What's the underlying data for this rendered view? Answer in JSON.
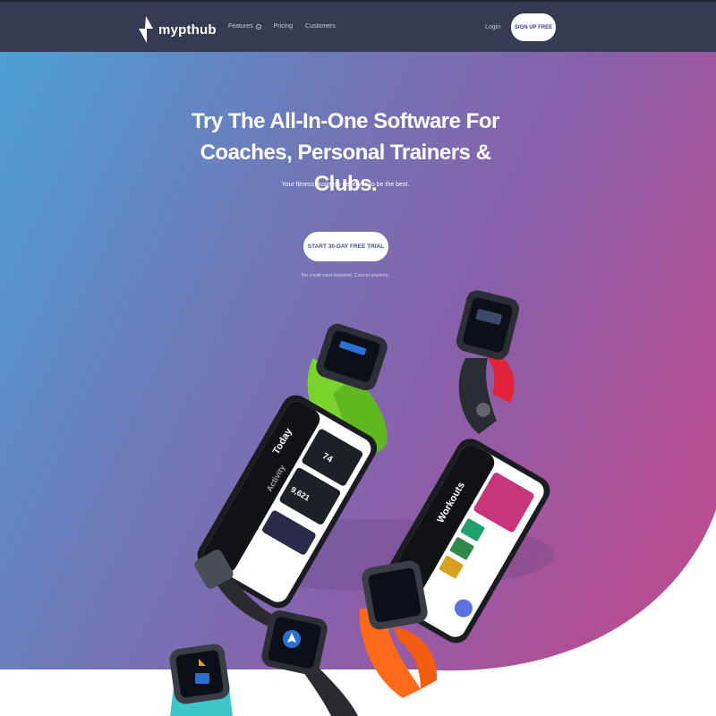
{
  "header": {
    "brand": "mypthub",
    "nav": [
      {
        "label": "Features",
        "has_dropdown": true
      },
      {
        "label": "Pricing"
      },
      {
        "label": "Customers"
      }
    ],
    "login_label": "Login",
    "signup_label": "SIGN UP FREE"
  },
  "hero": {
    "title_line1": "Try The All-In-One Software For",
    "title_line2": "Coaches, Personal Trainers & Clubs.",
    "subtitle": "Your fitness business deserves to be the best.",
    "cta_label": "START 30-DAY FREE TRIAL",
    "cta_note": "No credit card required. Cancel anytime."
  },
  "devices": {
    "phone_left_tabs": [
      "Today",
      "Activity"
    ],
    "phone_left_stat_1": "74",
    "phone_left_stat_2": "9,621",
    "phone_right_title": "Workouts"
  },
  "colors": {
    "header_bg": "#363a52",
    "gradient_start": "#4aa3d6",
    "gradient_end": "#c24d8e",
    "button_text": "#3d3e7c"
  }
}
